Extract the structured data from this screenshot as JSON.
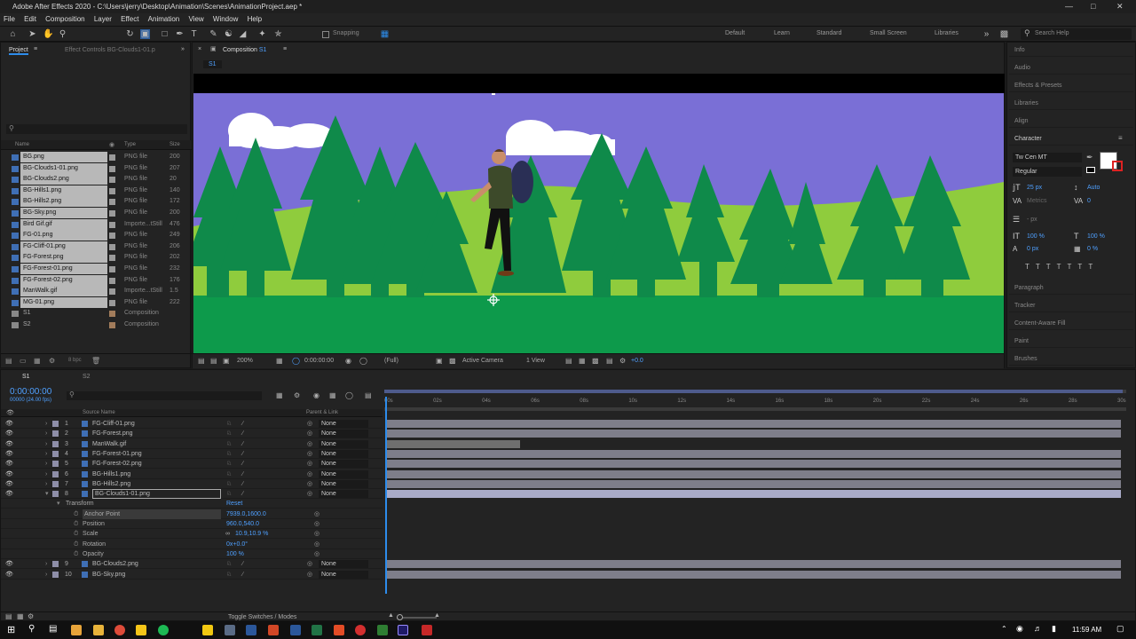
{
  "window": {
    "title": "Adobe After Effects 2020 - C:\\Users\\jerry\\Desktop\\Animation\\Scenes\\AnimationProject.aep *"
  },
  "menu": [
    "File",
    "Edit",
    "Composition",
    "Layer",
    "Effect",
    "Animation",
    "View",
    "Window",
    "Help"
  ],
  "toolbar": {
    "snapping": "Snapping",
    "workspaces": [
      "Default",
      "Learn",
      "Standard",
      "Small Screen",
      "Libraries"
    ],
    "search_placeholder": "Search Help"
  },
  "project": {
    "tab_project": "Project",
    "tab_effect": "Effect Controls BG-Clouds1-01.p",
    "col_name": "Name",
    "col_type": "Type",
    "col_size": "Size",
    "items": [
      {
        "name": "BG.png",
        "type": "PNG file",
        "size": "200"
      },
      {
        "name": "BG-Clouds1-01.png",
        "type": "PNG file",
        "size": "207"
      },
      {
        "name": "BG-Clouds2.png",
        "type": "PNG file",
        "size": "20"
      },
      {
        "name": "BG-Hills1.png",
        "type": "PNG file",
        "size": "140"
      },
      {
        "name": "BG-Hills2.png",
        "type": "PNG file",
        "size": "172"
      },
      {
        "name": "BG-Sky.png",
        "type": "PNG file",
        "size": "200"
      },
      {
        "name": "Bird Gif.gif",
        "type": "Importe...tStill",
        "size": "476"
      },
      {
        "name": "FG-01.png",
        "type": "PNG file",
        "size": "249"
      },
      {
        "name": "FG-Cliff-01.png",
        "type": "PNG file",
        "size": "206"
      },
      {
        "name": "FG-Forest.png",
        "type": "PNG file",
        "size": "202"
      },
      {
        "name": "FG-Forest-01.png",
        "type": "PNG file",
        "size": "232"
      },
      {
        "name": "FG-Forest-02.png",
        "type": "PNG file",
        "size": "176"
      },
      {
        "name": "ManWalk.gif",
        "type": "Importe...tStill",
        "size": "1.5"
      },
      {
        "name": "MG-01.png",
        "type": "PNG file",
        "size": "222"
      },
      {
        "name": "S1",
        "type": "Composition",
        "size": ""
      },
      {
        "name": "S2",
        "type": "Composition",
        "size": ""
      }
    ],
    "bpc": "8 bpc"
  },
  "comp": {
    "tab": "Composition",
    "tab_name": "S1",
    "sub": "S1",
    "zoom": "200%",
    "time": "0:00:00:00",
    "res": "(Full)",
    "camera": "Active Camera",
    "view": "1 View",
    "exposure": "+0.0"
  },
  "right": {
    "items_top": [
      "Info",
      "Audio",
      "Effects & Presets",
      "Libraries",
      "Align"
    ],
    "character": "Character",
    "font": "Tw Cen MT",
    "style": "Regular",
    "size": "25 px",
    "leading": "Auto",
    "tracking_metrics": "Metrics",
    "tracking_value": "0",
    "px": "- px",
    "v_scale": "100 %",
    "h_scale": "100 %",
    "baseline": "0 px",
    "tsume": "0 %",
    "items_bottom": [
      "Paragraph",
      "Tracker",
      "Content-Aware Fill",
      "Paint",
      "Brushes"
    ]
  },
  "timeline": {
    "tabs": [
      "S1",
      "S2"
    ],
    "timecode": "0:00:00:00",
    "fps": "00000 (24.00 fps)",
    "col_source": "Source Name",
    "col_parent": "Parent & Link",
    "ticks": [
      "00s",
      "02s",
      "04s",
      "06s",
      "08s",
      "10s",
      "12s",
      "14s",
      "16s",
      "18s",
      "20s",
      "22s",
      "24s",
      "26s",
      "28s",
      "30s"
    ],
    "layers": [
      {
        "num": "1",
        "name": "FG-Cliff-01.png",
        "parent": "None"
      },
      {
        "num": "2",
        "name": "FG-Forest.png",
        "parent": "None"
      },
      {
        "num": "3",
        "name": "ManWalk.gif",
        "parent": "None"
      },
      {
        "num": "4",
        "name": "FG-Forest-01.png",
        "parent": "None"
      },
      {
        "num": "5",
        "name": "FG-Forest-02.png",
        "parent": "None"
      },
      {
        "num": "6",
        "name": "BG-Hills1.png",
        "parent": "None"
      },
      {
        "num": "7",
        "name": "BG-Hills2.png",
        "parent": "None"
      },
      {
        "num": "8",
        "name": "BG-Clouds1-01.png",
        "parent": "None"
      }
    ],
    "transform": {
      "label": "Transform",
      "reset": "Reset",
      "props": [
        {
          "name": "Anchor Point",
          "value": "7939.0,1600.0"
        },
        {
          "name": "Position",
          "value": "960.0,540.0"
        },
        {
          "name": "Scale",
          "value": "10.9,10.9 %"
        },
        {
          "name": "Rotation",
          "value": "0x+0.0°"
        },
        {
          "name": "Opacity",
          "value": "100 %"
        }
      ]
    },
    "layers2": [
      {
        "num": "9",
        "name": "BG-Clouds2.png",
        "parent": "None"
      },
      {
        "num": "10",
        "name": "BG-Sky.png",
        "parent": "None"
      }
    ],
    "toggle": "Toggle Switches / Modes"
  },
  "taskbar": {
    "time": "11:59 AM"
  },
  "colors": {
    "sky": "#7a6fd6",
    "grass": "#8fcc3d",
    "ground": "#0d9a4b",
    "tree": "#0f8a4a",
    "accent": "#2d8ceb"
  }
}
